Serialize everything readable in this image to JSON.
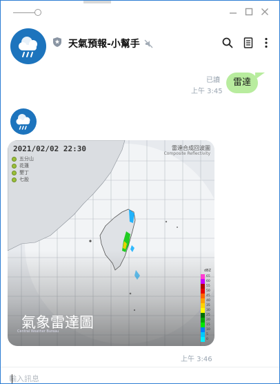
{
  "header": {
    "title": "天氣預報-小幫手"
  },
  "messages": {
    "sent": {
      "text": "雷達",
      "read_label": "已讀",
      "time": "上午 3:45"
    },
    "received": {
      "time": "上午 3:46",
      "card": {
        "date": "2021/02/02  22:30",
        "legend": [
          "五分山",
          "花蓮",
          "墾丁",
          "七股"
        ],
        "title_zh": "雷達合成回波圖",
        "title_en": "Composite Reflectivity",
        "caption": "氣象雷達圖",
        "org": "Central Weather Bureau",
        "unit": "dBZ",
        "scale": [
          {
            "label": "65",
            "color": "#ff3ccf"
          },
          {
            "label": "60",
            "color": "#c800ff"
          },
          {
            "label": "55",
            "color": "#b40000"
          },
          {
            "label": "50",
            "color": "#e60000"
          },
          {
            "label": "45",
            "color": "#ff6400"
          },
          {
            "label": "40",
            "color": "#ffa000"
          },
          {
            "label": "35",
            "color": "#ffd200"
          },
          {
            "label": "30",
            "color": "#ffff00"
          },
          {
            "label": "25",
            "color": "#006e00"
          },
          {
            "label": "20",
            "color": "#00aa00"
          },
          {
            "label": "15",
            "color": "#00e600"
          },
          {
            "label": "10",
            "color": "#0080ff"
          },
          {
            "label": "5",
            "color": "#00c8ff"
          },
          {
            "label": "0",
            "color": "#00f0ff"
          }
        ]
      }
    }
  },
  "input": {
    "placeholder": "輸入訊息"
  },
  "colors": {
    "accent_blue": "#1d74bd",
    "bubble_green": "#b8ec9e",
    "meta_gray": "#9aa5b1"
  },
  "icons": {
    "pin": "pin-slider-icon",
    "minimize": "minimize-icon",
    "maximize": "maximize-icon",
    "close": "close-icon",
    "shield": "shield-icon",
    "mute": "mute-icon",
    "search": "search-icon",
    "notes": "notes-icon",
    "more": "more-vertical-icon"
  }
}
